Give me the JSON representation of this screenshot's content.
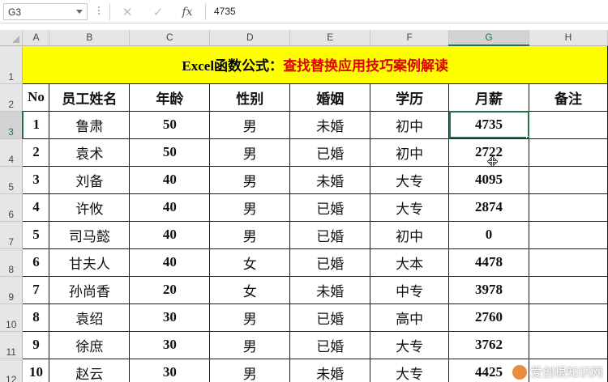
{
  "formula_bar": {
    "name_box": "G3",
    "cancel_icon": "✕",
    "enter_icon": "✓",
    "fx_label": "fx",
    "value": "4735"
  },
  "columns": [
    "A",
    "B",
    "C",
    "D",
    "E",
    "F",
    "G",
    "H"
  ],
  "selected_column": "G",
  "row_numbers": [
    "1",
    "2",
    "3",
    "4",
    "5",
    "6",
    "7",
    "8",
    "9",
    "10",
    "11",
    "12"
  ],
  "selected_row": "3",
  "title": {
    "part1": "Excel函数公式：",
    "part2": "查找替换应用技巧案例解读",
    "background": "#ffff00",
    "part1_color": "#000000",
    "part2_color": "#e00000"
  },
  "headers": [
    "No",
    "员工姓名",
    "年龄",
    "性别",
    "婚姻",
    "学历",
    "月薪",
    "备注"
  ],
  "rows": [
    {
      "no": "1",
      "name": "鲁肃",
      "age": "50",
      "gender": "男",
      "marriage": "未婚",
      "edu": "初中",
      "salary": "4735",
      "note": ""
    },
    {
      "no": "2",
      "name": "袁术",
      "age": "50",
      "gender": "男",
      "marriage": "已婚",
      "edu": "初中",
      "salary": "2722",
      "note": ""
    },
    {
      "no": "3",
      "name": "刘备",
      "age": "40",
      "gender": "男",
      "marriage": "未婚",
      "edu": "大专",
      "salary": "4095",
      "note": ""
    },
    {
      "no": "4",
      "name": "许攸",
      "age": "40",
      "gender": "男",
      "marriage": "已婚",
      "edu": "大专",
      "salary": "2874",
      "note": ""
    },
    {
      "no": "5",
      "name": "司马懿",
      "age": "40",
      "gender": "男",
      "marriage": "已婚",
      "edu": "初中",
      "salary": "0",
      "note": ""
    },
    {
      "no": "6",
      "name": "甘夫人",
      "age": "40",
      "gender": "女",
      "marriage": "已婚",
      "edu": "大本",
      "salary": "4478",
      "note": ""
    },
    {
      "no": "7",
      "name": "孙尚香",
      "age": "20",
      "gender": "女",
      "marriage": "未婚",
      "edu": "中专",
      "salary": "3978",
      "note": ""
    },
    {
      "no": "8",
      "name": "袁绍",
      "age": "30",
      "gender": "男",
      "marriage": "已婚",
      "edu": "高中",
      "salary": "2760",
      "note": ""
    },
    {
      "no": "9",
      "name": "徐庶",
      "age": "30",
      "gender": "男",
      "marriage": "已婚",
      "edu": "大专",
      "salary": "3762",
      "note": ""
    },
    {
      "no": "10",
      "name": "赵云",
      "age": "30",
      "gender": "男",
      "marriage": "未婚",
      "edu": "大专",
      "salary": "4425",
      "note": ""
    }
  ],
  "watermark": "爱创根知识网",
  "accent_color": "#217346"
}
